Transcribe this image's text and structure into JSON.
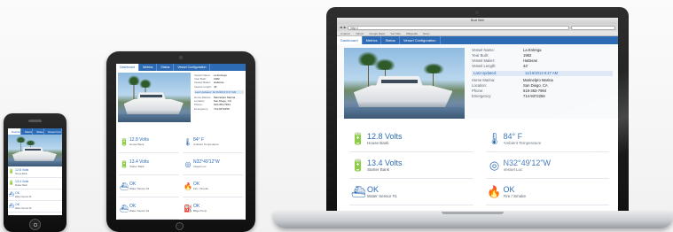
{
  "tabs": [
    "Dashboard",
    "Metrics",
    "Status",
    "Vessel Configuration"
  ],
  "browser": {
    "window_title": "Boat Web",
    "address": "http://",
    "bookmarks": [
      "Amazon",
      "Yahoo!",
      "Google Maps",
      "YouTube",
      "Wikipedia",
      "News"
    ]
  },
  "vessel": [
    {
      "key": "Vessel Name:",
      "value": "La Entrega"
    },
    {
      "key": "Year Built:",
      "value": "1982"
    },
    {
      "key": "Vessel Maker:",
      "value": "Hatteras"
    },
    {
      "key": "Vessel Length:",
      "value": "44'"
    }
  ],
  "last_updated": {
    "label": "Last Updated:",
    "value": "11/16/2013 8:47 AM"
  },
  "marina": [
    {
      "key": "Home Marina:",
      "value": "Marinelpro Marina"
    },
    {
      "key": "Location:",
      "value": "San Diego, CA"
    },
    {
      "key": "Phone:",
      "value": "619-363-7994"
    },
    {
      "key": "Emergency:",
      "value": "714-9372256"
    }
  ],
  "cards": [
    {
      "icon": "battery-icon",
      "glyph": "🔋",
      "value": "12.8 Volts",
      "label": "House Bank"
    },
    {
      "icon": "thermometer-icon",
      "glyph": "🌡",
      "value": "84° F",
      "label": "Ambient Temperature"
    },
    {
      "icon": "battery-icon",
      "glyph": "🔋",
      "value": "13.4 Volts",
      "label": "Starter Bank"
    },
    {
      "icon": "gps-icon",
      "glyph": "◎",
      "value": "N32°49'12\"W",
      "label": "Vessel Loc"
    },
    {
      "icon": "boat-icon",
      "glyph": "⛴",
      "value": "OK",
      "label": "Water Sensor #1"
    },
    {
      "icon": "flame-icon",
      "glyph": "🔥",
      "value": "OK",
      "label": "Fire / Smoke"
    },
    {
      "icon": "boat-icon",
      "glyph": "⛴",
      "value": "OK",
      "label": "Water Sensor #2"
    },
    {
      "icon": "fuel-icon",
      "glyph": "⛽",
      "value": "OK",
      "label": "Bilge Pump"
    }
  ],
  "colors": {
    "accent": "#2d6bb5",
    "device_frame": "#1d1d1d",
    "laptop_base": "#c9ccd0"
  }
}
